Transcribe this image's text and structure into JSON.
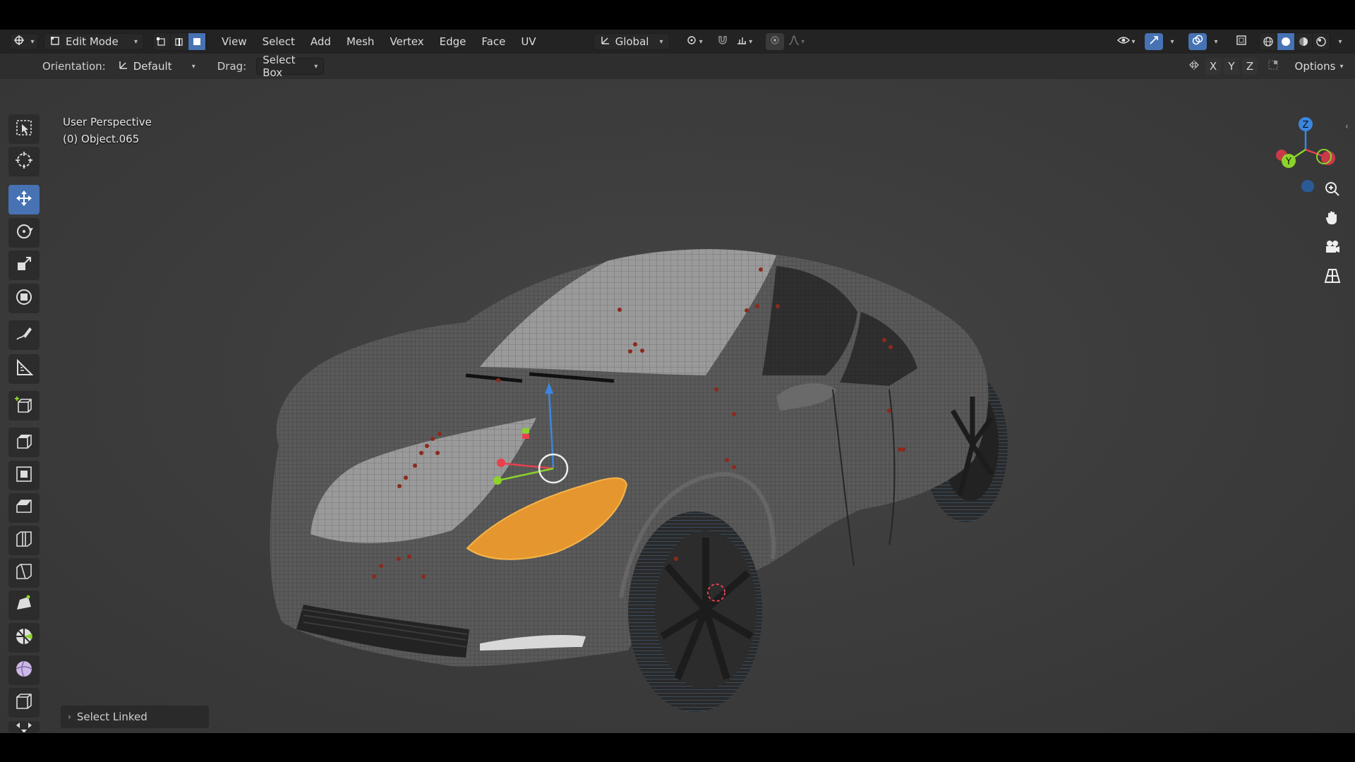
{
  "header": {
    "editor_type_icon": "view3d-icon",
    "mode": "Edit Mode",
    "select_modes": [
      "vertex-select-icon",
      "edge-select-icon",
      "face-select-icon"
    ],
    "menus": [
      "View",
      "Select",
      "Add",
      "Mesh",
      "Vertex",
      "Edge",
      "Face",
      "UV"
    ],
    "transform_orientation": "Global",
    "right_icons": [
      "visibility-icon",
      "gizmo-icon",
      "overlay-icon",
      "xray-icon",
      "wireframe-shading-icon",
      "solid-shading-icon",
      "material-shading-icon",
      "rendered-shading-icon"
    ]
  },
  "toolsettings": {
    "orientation_label": "Orientation:",
    "orientation_value": "Default",
    "drag_label": "Drag:",
    "drag_value": "Select Box",
    "axis_x": "X",
    "axis_y": "Y",
    "axis_z": "Z",
    "options_label": "Options"
  },
  "viewport": {
    "view_name": "User Perspective",
    "object_name": "(0) Object.065"
  },
  "toolbar": {
    "tools": [
      "select-box",
      "cursor",
      "move",
      "rotate",
      "scale",
      "transform",
      "annotate",
      "measure",
      "add-cube",
      "extrude",
      "inset",
      "bevel",
      "loop-cut",
      "knife",
      "poly-build",
      "spin",
      "smooth",
      "edge-slide",
      "shrink-fatten"
    ],
    "active_tool": "move"
  },
  "navigation": {
    "gizmo_axes": [
      "X",
      "Y",
      "Z"
    ],
    "tools": [
      "zoom-icon",
      "pan-hand-icon",
      "camera-icon",
      "perspective-grid-icon"
    ]
  },
  "last_operator": "Select Linked",
  "colors": {
    "accent": "#4772b3",
    "selection": "#f2a33a",
    "axis_x": "#e8414d",
    "axis_y": "#8bd32b",
    "axis_z": "#3b86e0"
  }
}
